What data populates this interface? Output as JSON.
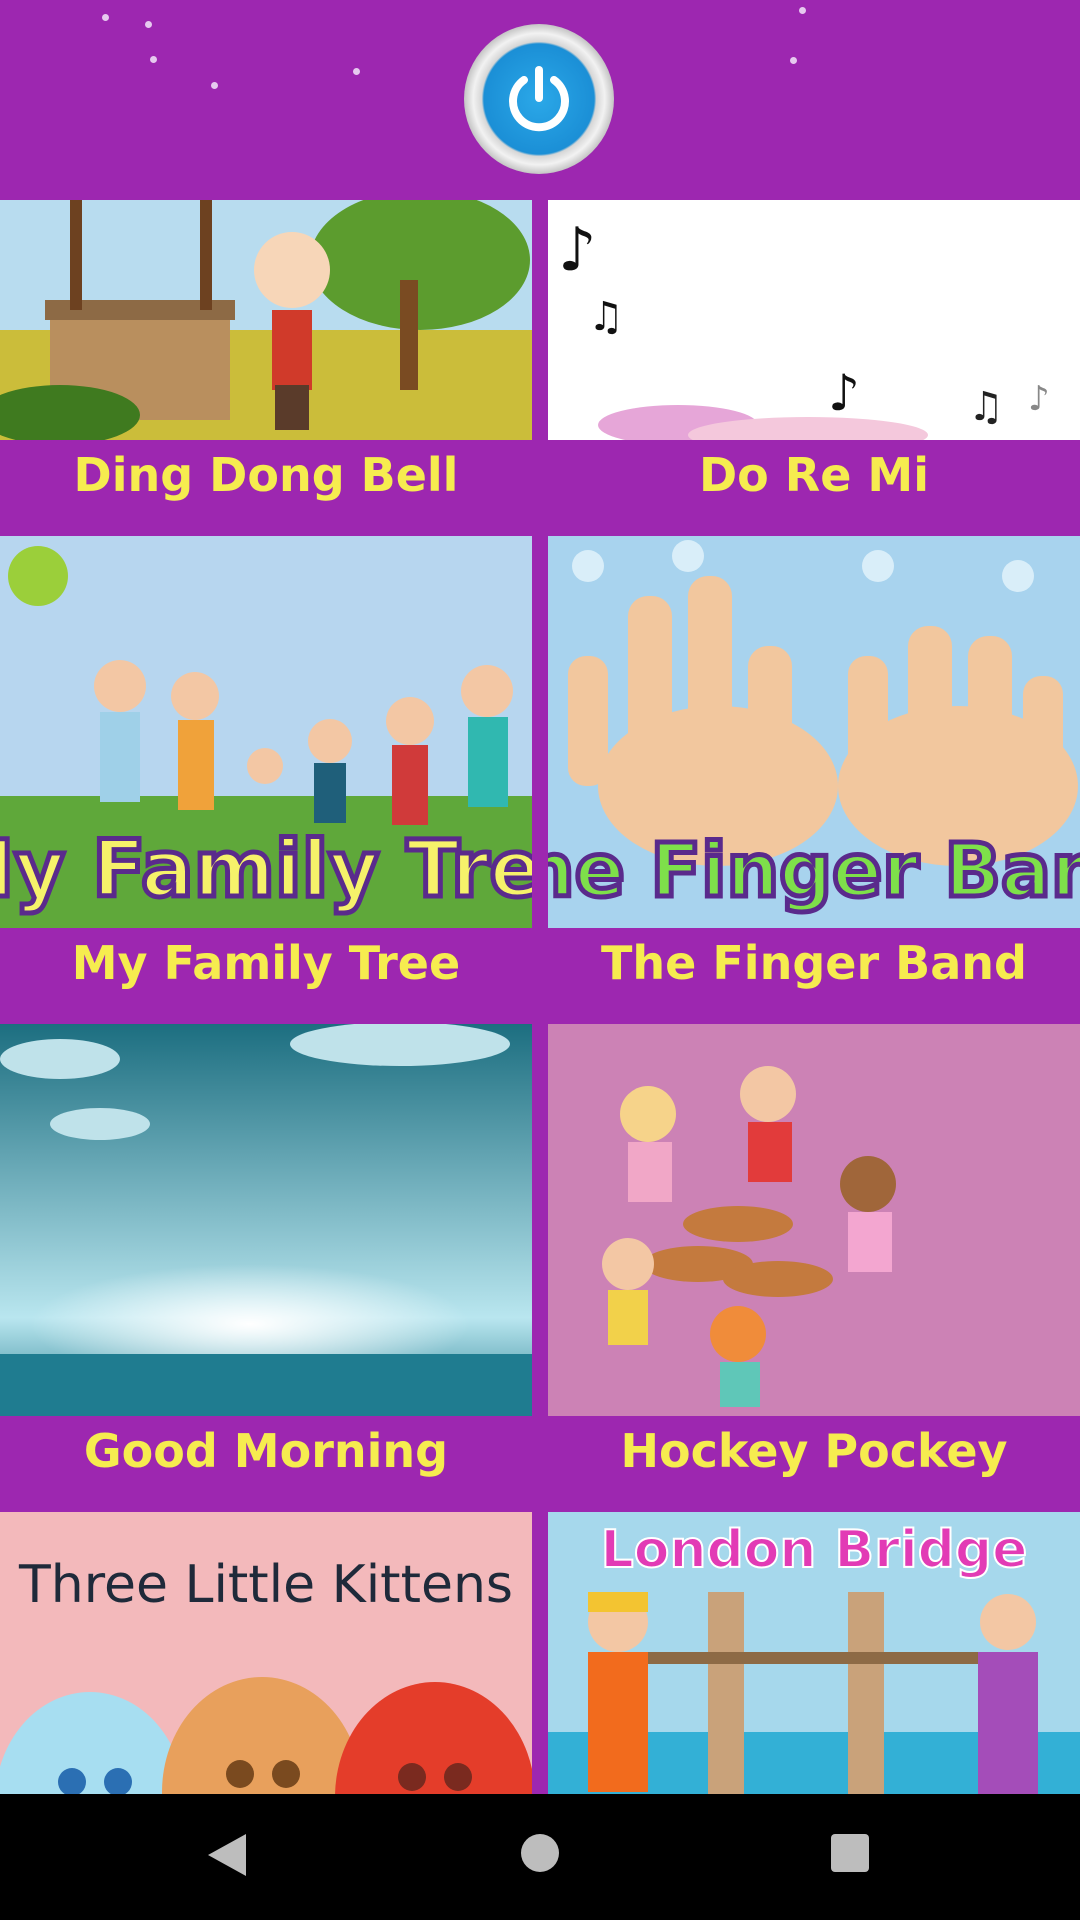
{
  "colors": {
    "background": "#9d27b0",
    "title_text": "#f6ec4f",
    "power_button": "#1b8fd6",
    "navbar": "#000000"
  },
  "header": {
    "power_icon": "power-icon"
  },
  "songs": [
    {
      "title": "Ding Dong Bell",
      "thumb_icon": "well-scene"
    },
    {
      "title": "Do Re Mi",
      "thumb_icon": "music-notes"
    },
    {
      "title": "My Family Tree",
      "thumb_text": "My Family Tree"
    },
    {
      "title": "The Finger Band",
      "thumb_text": "The Finger Band"
    },
    {
      "title": "Good Morning",
      "thumb_icon": "sunrise-scene"
    },
    {
      "title": "Hockey Pockey",
      "thumb_icon": "kids-dancing"
    },
    {
      "title": "",
      "thumb_text": "Three Little Kittens"
    },
    {
      "title": "",
      "thumb_text": "London Bridge"
    }
  ],
  "navbar": {
    "back": "back-icon",
    "home": "home-icon",
    "recents": "recents-icon"
  }
}
